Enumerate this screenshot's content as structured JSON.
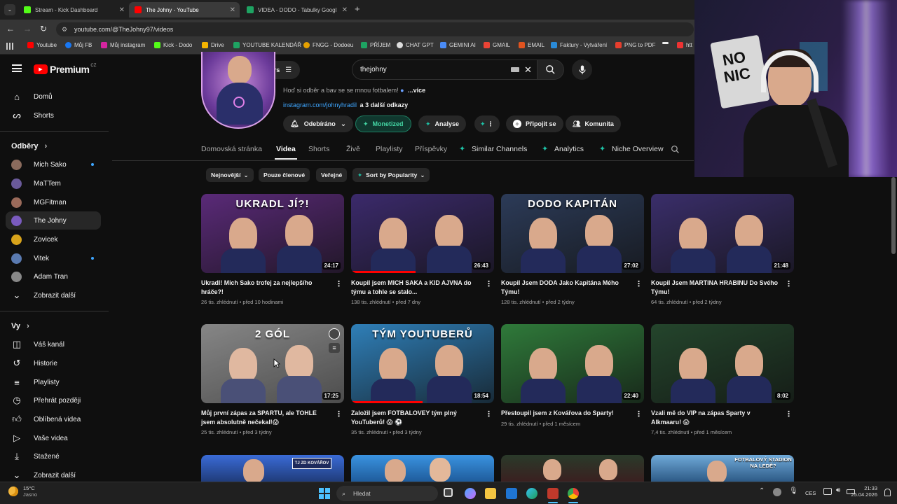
{
  "browser": {
    "tabs": [
      {
        "label": "Stream - Kick Dashboard",
        "color": "#53fc18"
      },
      {
        "label": "The Johny - YouTube",
        "color": "#ff0000"
      },
      {
        "label": "VIDEA - DODO - Tabulky Googl",
        "color": "#1ea362"
      }
    ],
    "url": "youtube.com/@TheJohny97/videos",
    "bookmarks": [
      "Youtube",
      "Můj FB",
      "Můj instagram",
      "Kick - Dodo",
      "Drive",
      "YOUTUBE KALENDÁŘ",
      "FNGG - Dodoeu",
      "PŘÍJEM",
      "CHAT GPT",
      "GEMINI AI",
      "GMAIL",
      "EMAIL",
      "Faktury - Vytváření",
      "PNG to PDF",
      "htt"
    ]
  },
  "header": {
    "logo": "Premium",
    "region": "CZ",
    "filters_label": "Filters",
    "search_value": "thejohny"
  },
  "channel": {
    "description": "Hoď si odběr a bav se se mnou fotbalem!",
    "description_more": "...více",
    "link": "instagram.com/johnyhradil",
    "link_more": "a 3 další odkazy",
    "buttons": {
      "subscribed": "Odebíráno",
      "monetized": "Monetized",
      "analyse": "Analyse",
      "join": "Připojit se",
      "community": "Komunita"
    },
    "tabs": [
      "Domovská stránka",
      "Videa",
      "Shorts",
      "Živě",
      "Playlisty",
      "Příspěvky",
      "Similar Channels",
      "Analytics",
      "Niche Overview"
    ],
    "chips": [
      "Nejnovější",
      "Pouze členové",
      "Veřejné",
      "Sort by Popularity"
    ]
  },
  "sidebar": {
    "nav": [
      {
        "label": "Domů",
        "icon": "home-icon"
      },
      {
        "label": "Shorts",
        "icon": "shorts-icon"
      }
    ],
    "subscriptions_title": "Odběry",
    "subscriptions": [
      {
        "label": "Mich Sako",
        "dot": true
      },
      {
        "label": "MaTTem",
        "dot": false
      },
      {
        "label": "MGFitman",
        "dot": false
      },
      {
        "label": "The Johny",
        "dot": false
      },
      {
        "label": "Zovicek",
        "dot": false
      },
      {
        "label": "Vitek",
        "dot": true
      },
      {
        "label": "Adam Tran",
        "dot": false
      }
    ],
    "show_more": "Zobrazit další",
    "you_title": "Vy",
    "you_items": [
      {
        "label": "Váš kanál",
        "icon": "channel-icon"
      },
      {
        "label": "Historie",
        "icon": "history-icon"
      },
      {
        "label": "Playlisty",
        "icon": "playlist-icon"
      },
      {
        "label": "Přehrát později",
        "icon": "watch-later-icon"
      },
      {
        "label": "Oblíbená videa",
        "icon": "like-icon"
      },
      {
        "label": "Vaše videa",
        "icon": "video-icon"
      },
      {
        "label": "Stažené",
        "icon": "download-icon"
      },
      {
        "label": "Zobrazit další",
        "icon": "chevron-down-icon"
      }
    ]
  },
  "videos": [
    {
      "title": "Ukradl! Mich Sako trofej za nejlepšího hráče?!",
      "meta": "26 tis. zhlédnutí • před 10 hodinami",
      "duration": "24:17",
      "thumb_text": "UKRADL JÍ?!",
      "bg": "#5a2a78",
      "progress": 0
    },
    {
      "title": "Koupil jsem MICH SAKA a KID AJVNA do týmu a tohle se stalo...",
      "meta": "138 tis. zhlédnutí • před 7 dny",
      "duration": "26:43",
      "thumb_text": "",
      "bg": "#3b2a6b",
      "progress": 0.45
    },
    {
      "title": "Koupil Jsem DODA Jako Kapitána Mého Týmu!",
      "meta": "128 tis. zhlédnutí • před 2 týdny",
      "duration": "27:02",
      "thumb_text": "DODO KAPITÁN",
      "bg": "#2c3b58",
      "progress": 0
    },
    {
      "title": "Koupil Jsem MARTINA HRABINU Do Svého Týmu!",
      "meta": "64 tis. zhlédnutí • před 2 týdny",
      "duration": "21:48",
      "thumb_text": "",
      "bg": "#3a2e6a",
      "progress": 0
    },
    {
      "title": "Můj první zápas za SPARTU, ale TOHLE jsem absolutně nečekal!😱",
      "meta": "25 tis. zhlédnutí • před 3 týdny",
      "duration": "17:25",
      "thumb_text": "2 GÓL",
      "bg": "#6c6c6c",
      "progress": 0
    },
    {
      "title": "Založil jsem FOTBALOVEY tým plný YouTuberů! 😱 ⚽",
      "meta": "35 tis. zhlédnutí • před 3 týdny",
      "duration": "18:54",
      "thumb_text": "TÝM YOUTUBERŮ",
      "bg": "#2f7fb8",
      "progress": 0.5
    },
    {
      "title": "Přestoupil jsem z Kovářova do Sparty!",
      "meta": "29 tis. zhlédnutí • před 1 měsícem",
      "duration": "22:40",
      "thumb_text": "",
      "bg": "#2f7a3a",
      "progress": 0
    },
    {
      "title": "Vzali mě do VIP na zápas Sparty v Alkmaaru! 😱",
      "meta": "7,4 tis. zhlédnutí • před 1 měsícem",
      "duration": "8:02",
      "thumb_text": "",
      "bg": "#24452c",
      "progress": 0
    }
  ],
  "bottom_row_text": [
    "TJ ZD KOVÁŘOV",
    "",
    "",
    "FOTBALOVÝ STADION NA LEDĚ?"
  ],
  "taskbar": {
    "weather_temp": "15°C",
    "weather_text": "Jasno",
    "search_placeholder": "Hledat",
    "lang": "CES",
    "time": "21:33",
    "date": "25.04.2026"
  },
  "webcam": {
    "text": "NO NIC"
  }
}
